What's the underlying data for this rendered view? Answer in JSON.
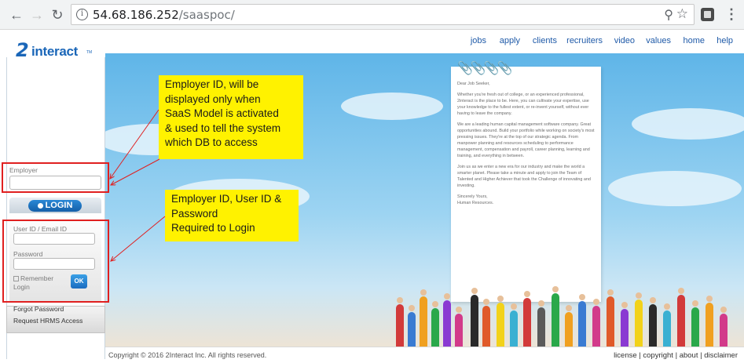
{
  "browser": {
    "url_host": "54.68.186.252",
    "url_path": "/saaspoc/",
    "icons": [
      "back-icon",
      "forward-icon",
      "reload-icon",
      "info-icon",
      "zoom-icon",
      "star-icon",
      "extension-icon",
      "menu-icon"
    ]
  },
  "logo": {
    "mark": "2",
    "text": "interact",
    "tm": "TM"
  },
  "nav": [
    {
      "label": "jobs"
    },
    {
      "label": "apply"
    },
    {
      "label": "clients"
    },
    {
      "label": "recruiters"
    },
    {
      "label": "video"
    },
    {
      "label": "values"
    },
    {
      "label": "home"
    },
    {
      "label": "help"
    }
  ],
  "login": {
    "employer_label": "Employer",
    "employer_value": "",
    "login_header": "LOGIN",
    "userid_label": "User ID / Email ID",
    "userid_value": "",
    "password_label": "Password",
    "password_value": "",
    "remember_label_1": "Remember",
    "remember_label_2": "Login",
    "ok_label": "OK",
    "forgot_password": "Forgot Password",
    "request_access": "Request HRMS Access"
  },
  "letter": {
    "greeting": "Dear Job Seeker,",
    "p1": "Whether you're fresh out of college, or an experienced professional, 2interact is the place to be. Here, you can cultivate your expertise, use your knowledge to the fullest extent, or re-invent yourself, without ever having to leave the company.",
    "p2": "We are a leading human capital management software company. Great opportunities abound. Build your portfolio while working on society's most pressing issues. They're at the top of our strategic agenda. From manpower planning and resources scheduling to performance management, compensation and payroll, career planning, learning and training, and everything in between.",
    "p3": "Join us as we enter a new era for our industry and make the world a smarter planet. Please take a minute and apply to join the Team of Talented and Higher Achiever that took the Challenge of innovating and investing.",
    "sign1": "Sincerely Yours,",
    "sign2": "Human Resources."
  },
  "footer": {
    "copyright": "Copyright © 2016 2Interact Inc. All rights reserved.",
    "links": [
      "license",
      "copyright",
      "about",
      "disclaimer"
    ]
  },
  "annotations": {
    "callout1": [
      "Employer ID, will be",
      "displayed only when",
      "SaaS Model is activated",
      "& used to tell the system",
      "which DB to access"
    ],
    "callout2": [
      "Employer ID, User ID &",
      "Password",
      "Required to Login"
    ]
  },
  "colors": {
    "annotation_red": "#e02020",
    "callout_yellow": "#fff200",
    "brand_blue": "#1a66b8",
    "link_blue": "#1f5aa8"
  }
}
